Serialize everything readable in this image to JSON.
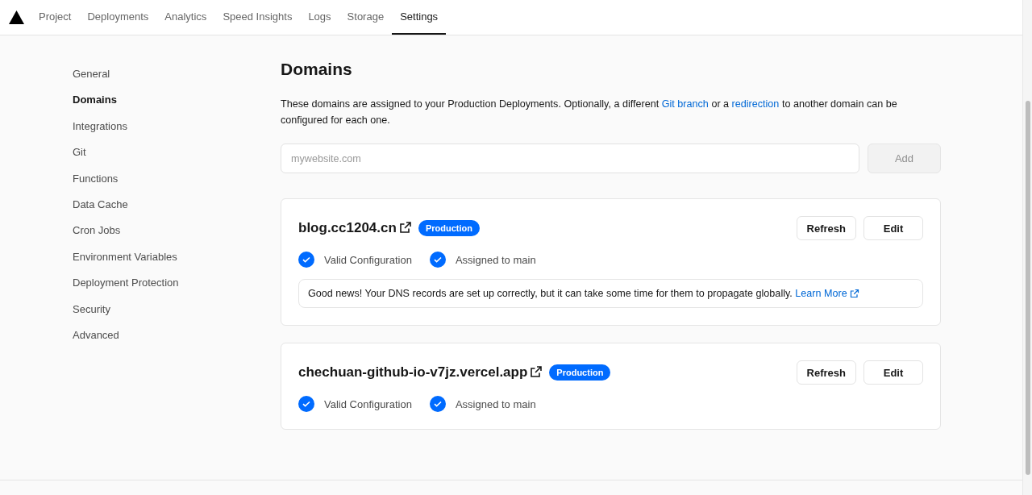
{
  "nav": {
    "tabs": [
      {
        "label": "Project",
        "selected": false
      },
      {
        "label": "Deployments",
        "selected": false
      },
      {
        "label": "Analytics",
        "selected": false
      },
      {
        "label": "Speed Insights",
        "selected": false
      },
      {
        "label": "Logs",
        "selected": false
      },
      {
        "label": "Storage",
        "selected": false
      },
      {
        "label": "Settings",
        "selected": true
      }
    ]
  },
  "sidebar": {
    "items": [
      {
        "label": "General",
        "selected": false
      },
      {
        "label": "Domains",
        "selected": true
      },
      {
        "label": "Integrations",
        "selected": false
      },
      {
        "label": "Git",
        "selected": false
      },
      {
        "label": "Functions",
        "selected": false
      },
      {
        "label": "Data Cache",
        "selected": false
      },
      {
        "label": "Cron Jobs",
        "selected": false
      },
      {
        "label": "Environment Variables",
        "selected": false
      },
      {
        "label": "Deployment Protection",
        "selected": false
      },
      {
        "label": "Security",
        "selected": false
      },
      {
        "label": "Advanced",
        "selected": false
      }
    ]
  },
  "main": {
    "title": "Domains",
    "description": {
      "before": "These domains are assigned to your Production Deployments. Optionally, a different",
      "link1": "Git branch",
      "middle": "or a",
      "link2": "redirection",
      "after": "to another domain can be configured for each one."
    },
    "add_form": {
      "placeholder": "mywebsite.com",
      "button": "Add",
      "disabled": true
    },
    "domains": [
      {
        "name": "blog.cc1204.cn",
        "badge": "Production",
        "buttons": [
          "Refresh",
          "Edit"
        ],
        "checks": [
          {
            "label": "Valid Configuration",
            "checked": true
          },
          {
            "label": "Assigned to main",
            "checked": true
          }
        ],
        "message": {
          "text": "Good news! Your DNS records are set up correctly, but it can take some time for them to propagate globally.",
          "link": "Learn More"
        }
      },
      {
        "name": "chechuan-github-io-v7jz.vercel.app",
        "badge": "Production",
        "buttons": [
          "Refresh",
          "Edit"
        ],
        "checks": [
          {
            "label": "Valid Configuration",
            "checked": true
          },
          {
            "label": "Assigned to main",
            "checked": true
          }
        ]
      }
    ]
  }
}
